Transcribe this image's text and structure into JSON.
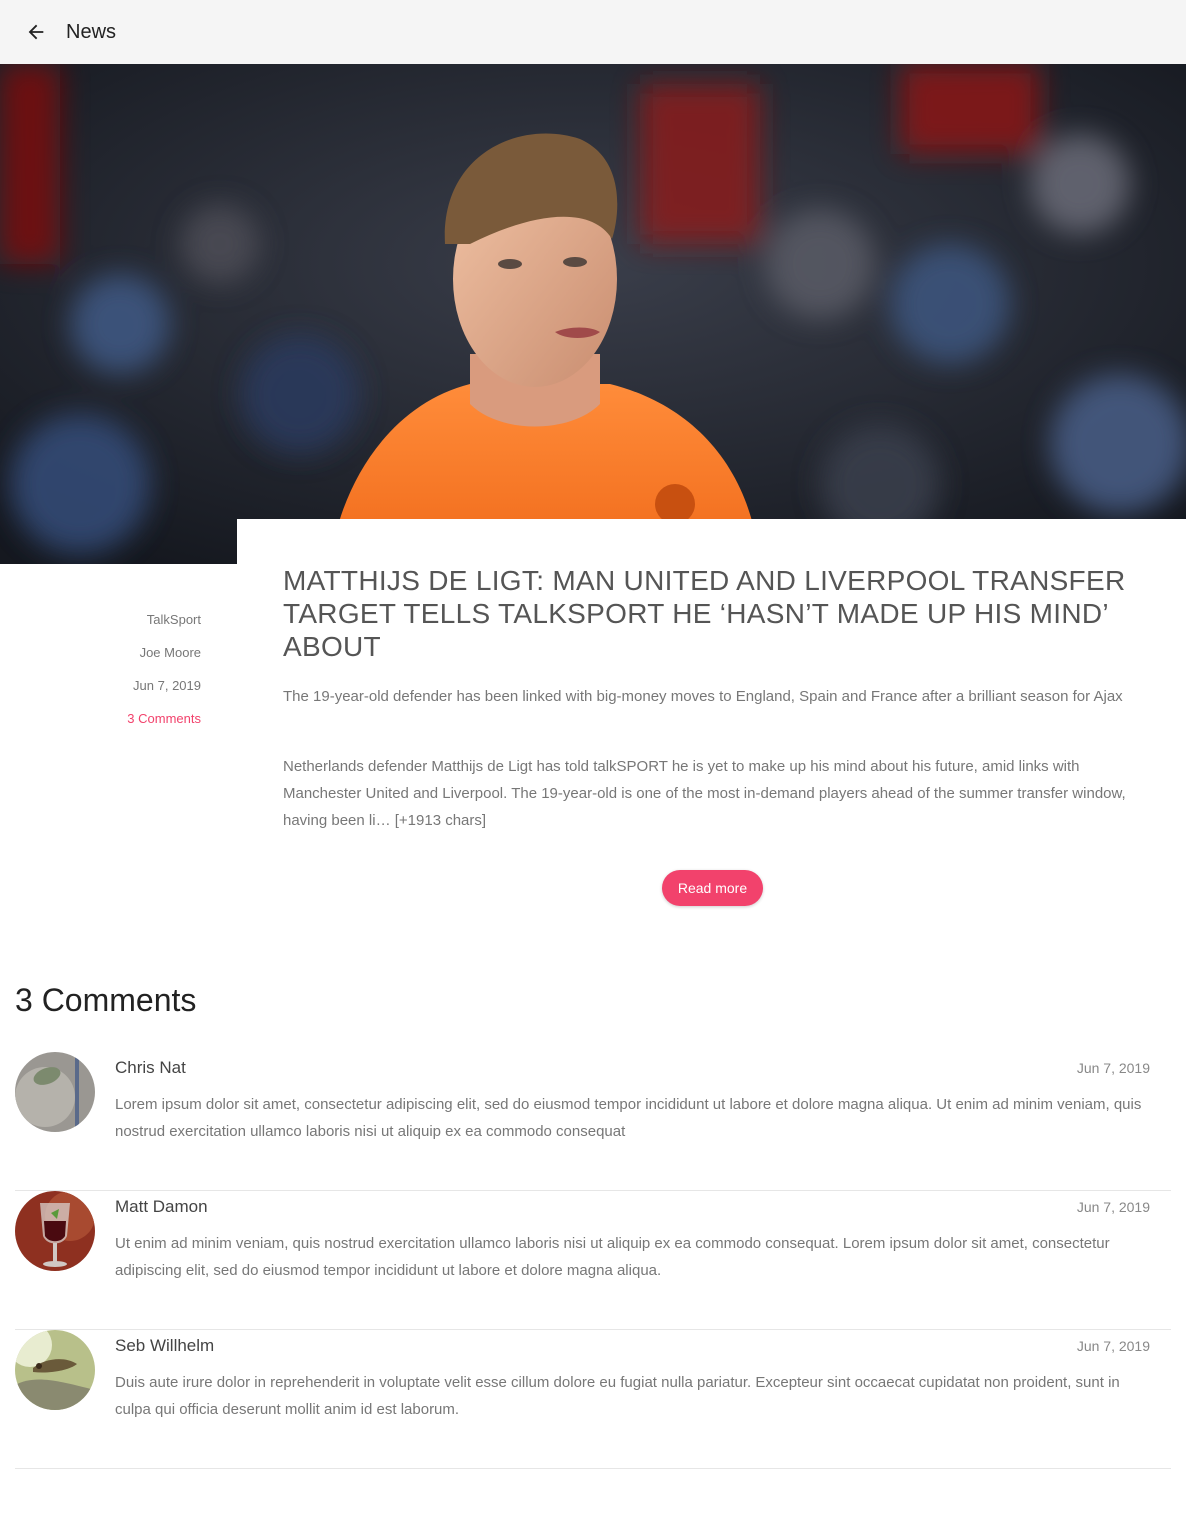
{
  "header": {
    "title": "News",
    "back_icon": "arrow-left-icon"
  },
  "hero": {
    "image": "soccer-player-photo"
  },
  "article": {
    "source": "TalkSport",
    "author": "Joe Moore",
    "date": "Jun 7, 2019",
    "comments_link": "3 Comments",
    "title": "MATTHIJS DE LIGT: MAN UNITED AND LIVERPOOL TRANSFER TARGET TELLS TALKSPORT HE ‘HASN’T MADE UP HIS MIND’ ABOUT",
    "lead": "The 19-year-old defender has been linked with big-money moves to England, Spain and France after a brilliant season for Ajax",
    "body": "Netherlands defender Matthijs de Ligt has told talkSPORT he is yet to make up his mind about his future, amid links with Manchester United and Liverpool. The 19-year-old is one of the most in-demand players ahead of the summer transfer window, having been li… [+1913 chars]",
    "read_more_label": "Read more",
    "accent_color": "#f2426c"
  },
  "comments": {
    "heading": "3 Comments",
    "items": [
      {
        "name": "Chris Nat",
        "date": "Jun 7, 2019",
        "text": "Lorem ipsum dolor sit amet, consectetur adipiscing elit, sed do eiusmod tempor incididunt ut labore et dolore magna aliqua. Ut enim ad minim veniam, quis nostrud exercitation ullamco laboris nisi ut aliquip ex ea commodo consequat"
      },
      {
        "name": "Matt Damon",
        "date": "Jun 7, 2019",
        "text": "Ut enim ad minim veniam, quis nostrud exercitation ullamco laboris nisi ut aliquip ex ea commodo consequat. Lorem ipsum dolor sit amet, consectetur adipiscing elit, sed do eiusmod tempor incididunt ut labore et dolore magna aliqua."
      },
      {
        "name": "Seb Willhelm",
        "date": "Jun 7, 2019",
        "text": "Duis aute irure dolor in reprehenderit in voluptate velit esse cillum dolore eu fugiat nulla pariatur. Excepteur sint occaecat cupidatat non proident, sunt in culpa qui officia deserunt mollit anim id est laborum."
      }
    ]
  }
}
